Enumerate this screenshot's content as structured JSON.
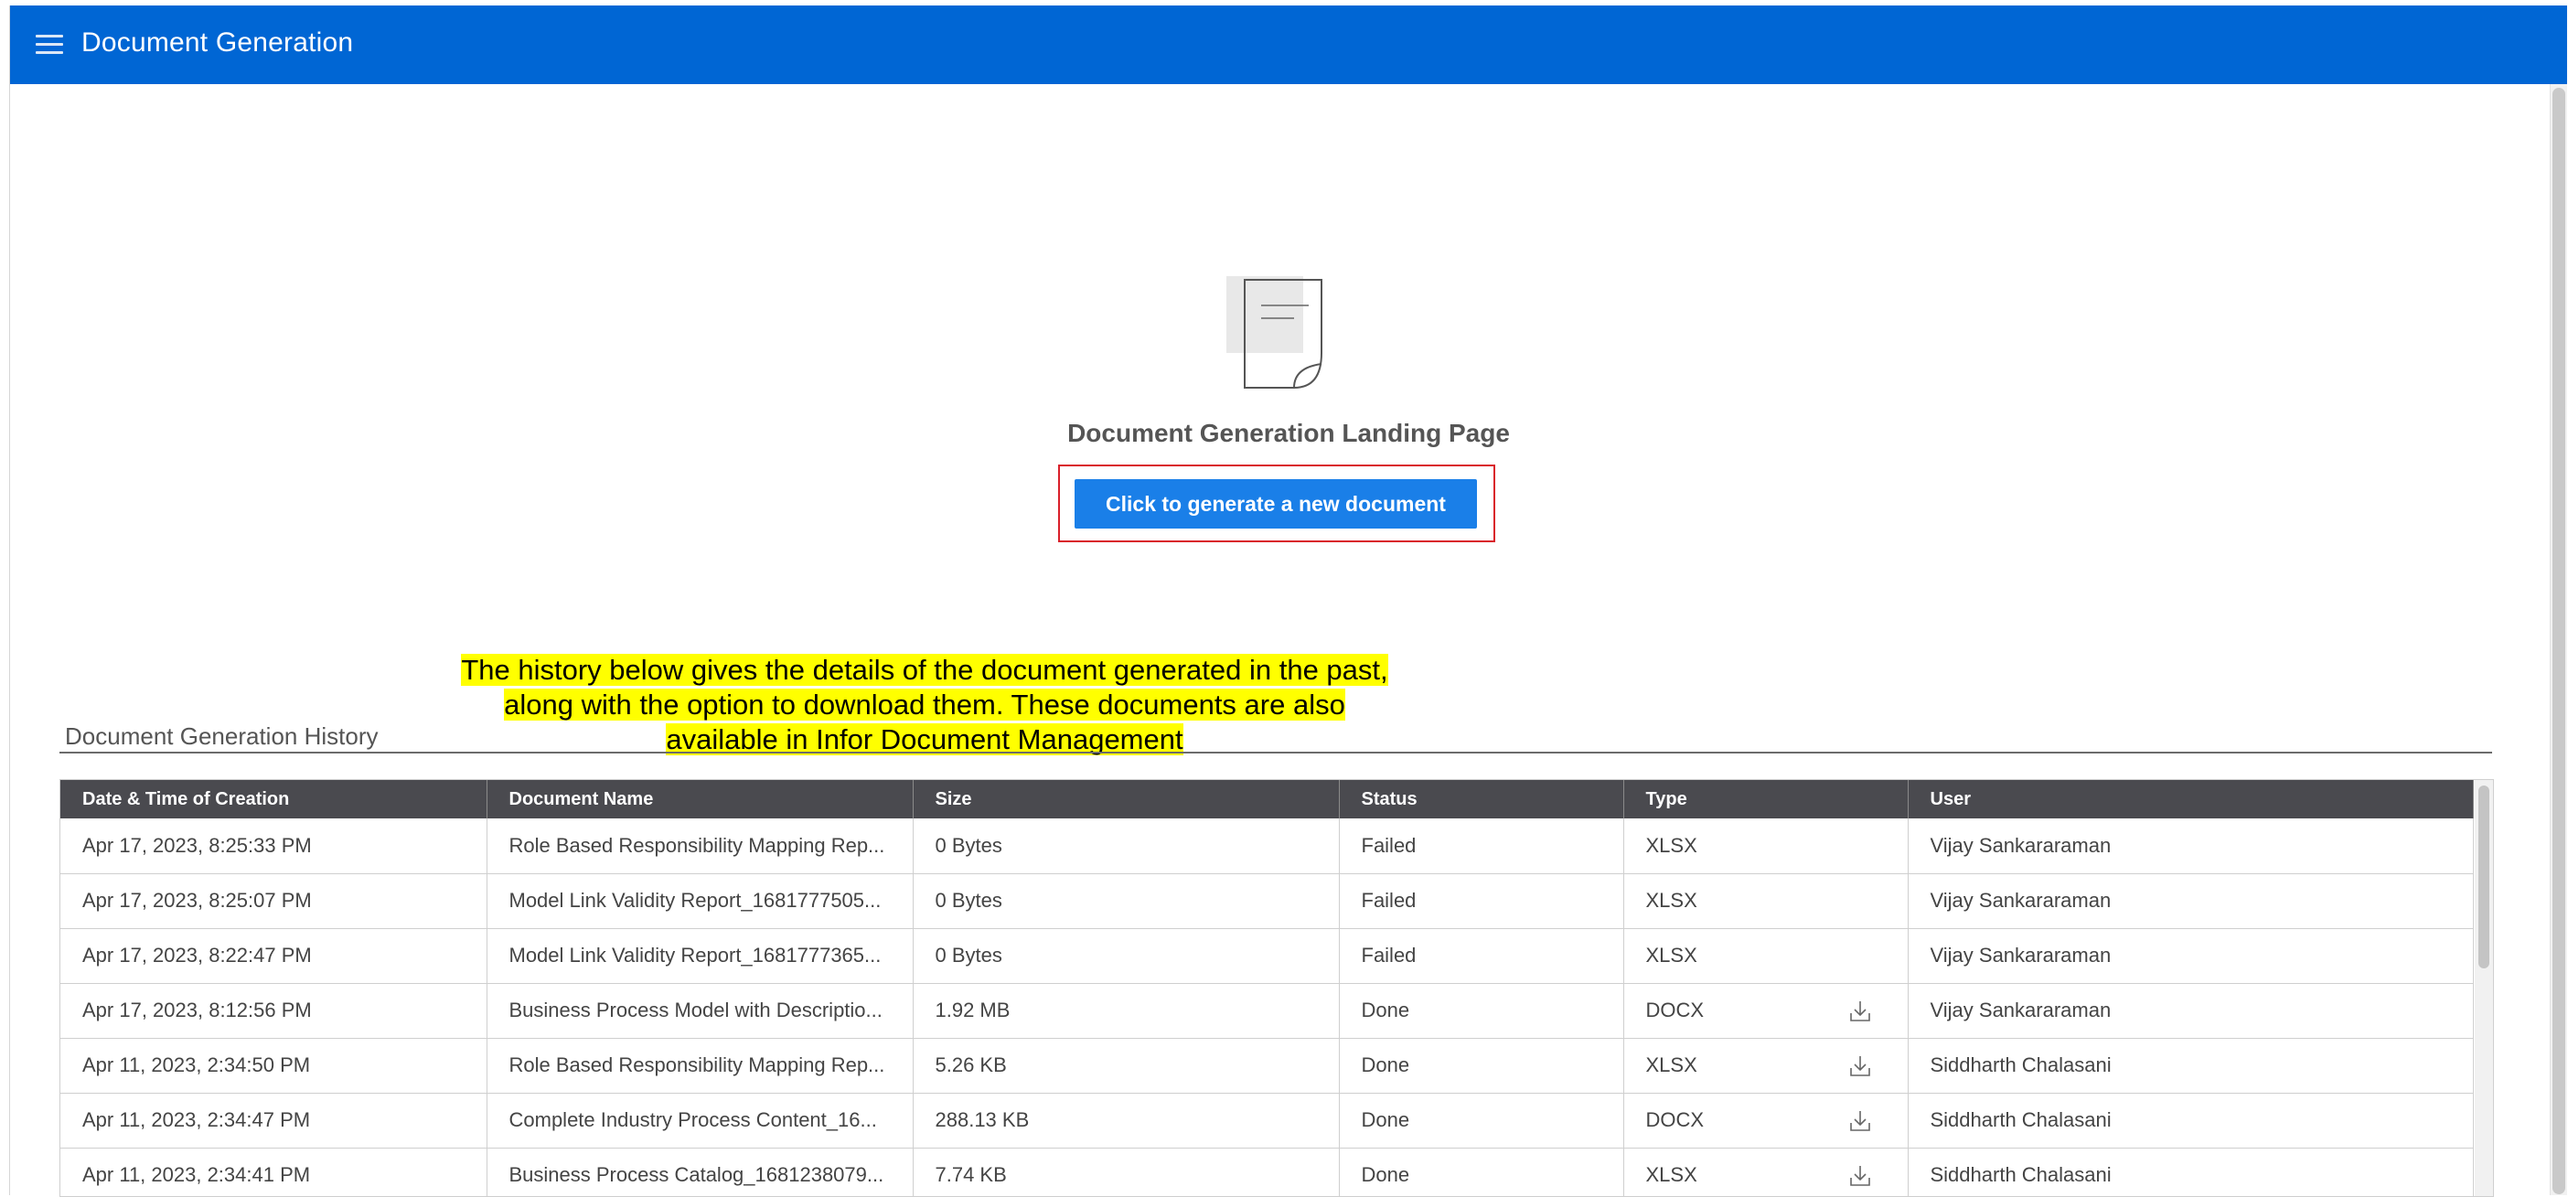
{
  "header": {
    "title": "Document Generation",
    "menu_icon": "hamburger-menu-icon",
    "background": "#0066d4"
  },
  "landing": {
    "icon": "document-icon",
    "title": "Document Generation Landing Page",
    "generate_button_label": "Click to generate a new document",
    "button_color": "#1a7fe8"
  },
  "callout": {
    "lines": [
      "The history below gives the details of the document generated in the past,",
      "along with the option to download them. These documents are also",
      "available in Infor Document Management"
    ],
    "highlight_color": "#ffff00"
  },
  "history": {
    "title": "Document Generation History",
    "columns": [
      "Date & Time of Creation",
      "Document Name",
      "Size",
      "Status",
      "Type",
      "User"
    ],
    "rows": [
      {
        "date": "Apr 17, 2023, 8:25:33 PM",
        "name": "Role Based Responsibility Mapping Rep...",
        "size": "0 Bytes",
        "status": "Failed",
        "type": "XLSX",
        "download": false,
        "user": "Vijay Sankararaman"
      },
      {
        "date": "Apr 17, 2023, 8:25:07 PM",
        "name": "Model Link Validity Report_1681777505...",
        "size": "0 Bytes",
        "status": "Failed",
        "type": "XLSX",
        "download": false,
        "user": "Vijay Sankararaman"
      },
      {
        "date": "Apr 17, 2023, 8:22:47 PM",
        "name": "Model Link Validity Report_1681777365...",
        "size": "0 Bytes",
        "status": "Failed",
        "type": "XLSX",
        "download": false,
        "user": "Vijay Sankararaman"
      },
      {
        "date": "Apr 17, 2023, 8:12:56 PM",
        "name": "Business Process Model with Descriptio...",
        "size": "1.92 MB",
        "status": "Done",
        "type": "DOCX",
        "download": true,
        "user": "Vijay Sankararaman"
      },
      {
        "date": "Apr 11, 2023, 2:34:50 PM",
        "name": "Role Based Responsibility Mapping Rep...",
        "size": "5.26 KB",
        "status": "Done",
        "type": "XLSX",
        "download": true,
        "user": "Siddharth Chalasani"
      },
      {
        "date": "Apr 11, 2023, 2:34:47 PM",
        "name": "Complete Industry Process Content_16...",
        "size": "288.13 KB",
        "status": "Done",
        "type": "DOCX",
        "download": true,
        "user": "Siddharth Chalasani"
      },
      {
        "date": "Apr 11, 2023, 2:34:41 PM",
        "name": "Business Process Catalog_1681238079...",
        "size": "7.74 KB",
        "status": "Done",
        "type": "XLSX",
        "download": true,
        "user": "Siddharth Chalasani"
      }
    ],
    "download_icon": "download-icon"
  }
}
